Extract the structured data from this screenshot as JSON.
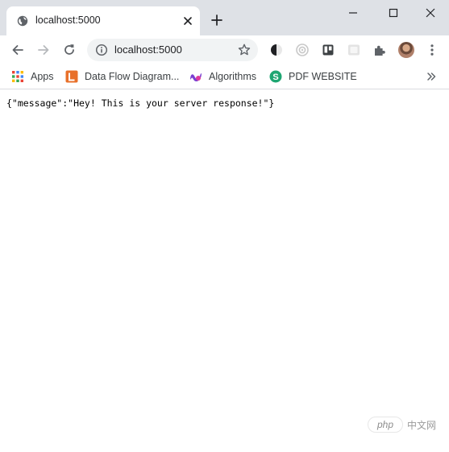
{
  "browser": {
    "tab": {
      "title": "localhost:5000",
      "favicon": "globe-icon",
      "close_icon": "close-icon"
    },
    "new_tab_icon": "plus-icon",
    "window_controls": [
      "minimize-icon",
      "maximize-icon",
      "close-icon"
    ]
  },
  "toolbar": {
    "back_icon": "arrow-left-icon",
    "forward_icon": "arrow-right-icon",
    "reload_icon": "reload-icon",
    "site_info_icon": "info-icon",
    "url": "localhost:5000",
    "bookmark_icon": "star-icon",
    "extensions": [
      "dark-mode-extension-icon",
      "camera-extension-icon",
      "trello-extension-icon",
      "grayscale-extension-icon",
      "puzzle-icon"
    ],
    "avatar": "avatar",
    "menu_icon": "kebab-menu-icon"
  },
  "bookmarks": {
    "items": [
      {
        "label": "Apps",
        "icon": "apps-grid-icon"
      },
      {
        "label": "Data Flow Diagram...",
        "icon": "lucidchart-icon"
      },
      {
        "label": "Algorithms",
        "icon": "algorithms-logo-icon"
      },
      {
        "label": "PDF WEBSITE",
        "icon": "pdf-s-icon"
      }
    ],
    "more_icon": "chevron-double-right-icon"
  },
  "page": {
    "response_text": "{\"message\":\"Hey! This is your server response!\"}"
  },
  "watermark": {
    "left_text": "php",
    "right_text": "中文网"
  },
  "colors": {
    "tabstrip_bg": "#dee1e6",
    "omnibox_bg": "#f1f3f4",
    "icon_gray": "#5f6368",
    "text_dark": "#202124"
  }
}
